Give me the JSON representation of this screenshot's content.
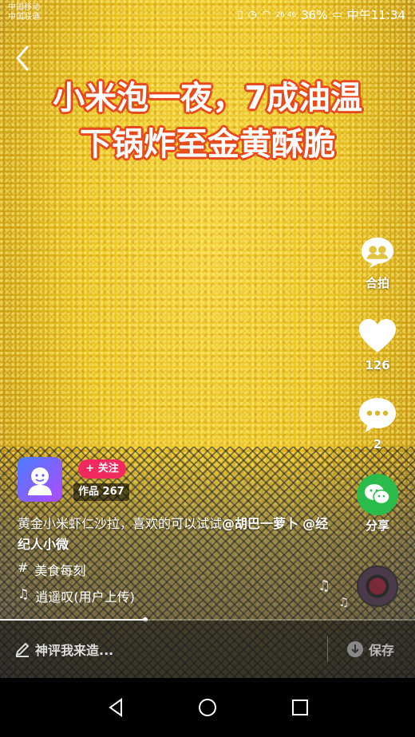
{
  "status_bar": {
    "carrier_line1": "中国移动",
    "carrier_line2": "中国联通",
    "network": "26 46",
    "battery": "36%",
    "time": "中午11:34"
  },
  "caption": {
    "line1": "小米泡一夜，7成油温",
    "line2": "下锅炸至金黄酥脆"
  },
  "actions": {
    "duet_label": "合拍",
    "like_count": "126",
    "comment_count": "2",
    "share_label": "分享"
  },
  "author": {
    "follow_label": "+ 关注",
    "works_label": "作品 267"
  },
  "description": {
    "text": "黄金小米虾仁沙拉，喜欢的可以试试",
    "mention1": "@胡巴一萝卜",
    "mention2": "@经纪人小微"
  },
  "tag": {
    "symbol": "#",
    "label": "美食每刻"
  },
  "music": {
    "symbol": "♫",
    "title": "逍遥叹(用户上传)"
  },
  "progress": {
    "fraction": 0.35
  },
  "comment_bar": {
    "placeholder": "神评我来造...",
    "save_label": "保存"
  },
  "colors": {
    "caption_outline": "#e84a1c",
    "follow": "#f2295d",
    "share_green": "#2bbb4a"
  }
}
